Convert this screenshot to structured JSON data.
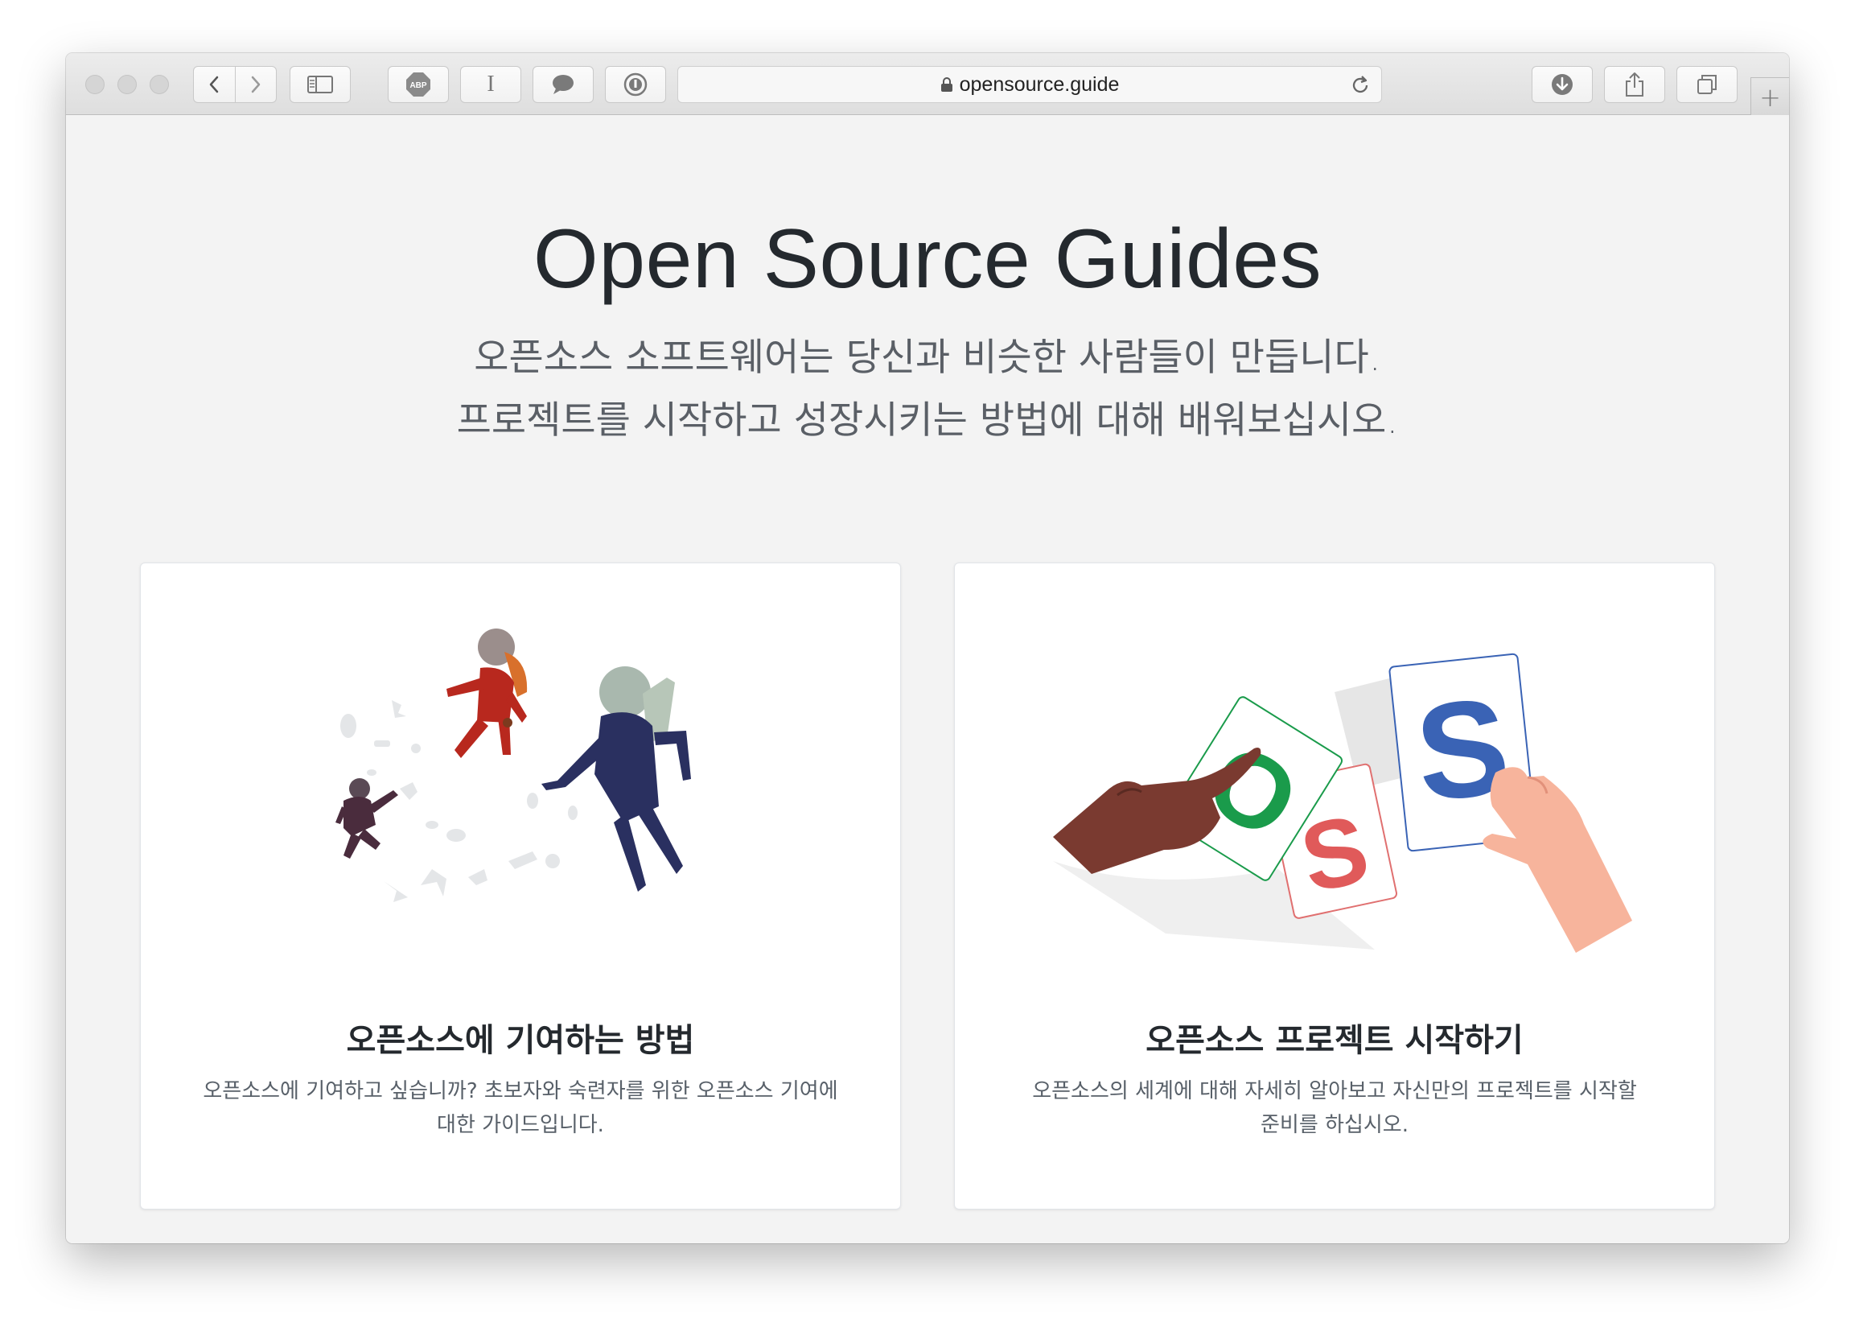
{
  "browser": {
    "url": "opensource.guide",
    "toolbar_icons": [
      "back-icon",
      "forward-icon",
      "sidebar-icon",
      "adblock-icon",
      "reader-icon",
      "chat-icon",
      "password-icon",
      "download-icon",
      "share-icon",
      "tabs-icon",
      "new-tab-icon",
      "lock-icon",
      "reload-icon"
    ],
    "adblock_label": "ABP",
    "reader_label": "I",
    "new_tab_label": "+"
  },
  "hero": {
    "title": "Open Source Guides",
    "subtitle_line1": "오픈소스 소프트웨어는 당신과 비슷한 사람들이 만듭니다.",
    "subtitle_line2": "프로젝트를 시작하고 성장시키는 방법에 대해 배워보십시오."
  },
  "cards": [
    {
      "title": "오픈소스에 기여하는 방법",
      "desc_line1": "오픈소스에 기여하고 싶습니까? 초보자와 숙련자를 위한 오픈소스 기여에",
      "desc_line2": "대한 가이드입니다."
    },
    {
      "title": "오픈소스 프로젝트 시작하기",
      "desc_line1": "오픈소스의 세계에 대해 자세히 알아보고 자신만의 프로젝트를 시작할",
      "desc_line2": "준비를 하십시오.",
      "card_letters": [
        "O",
        "S",
        "S"
      ]
    }
  ],
  "colors": {
    "page_bg": "#f3f3f3",
    "title": "#24292e",
    "letter_green": "#1a9b4b",
    "letter_blue": "#3a63b5",
    "letter_red": "#e05a5a"
  }
}
